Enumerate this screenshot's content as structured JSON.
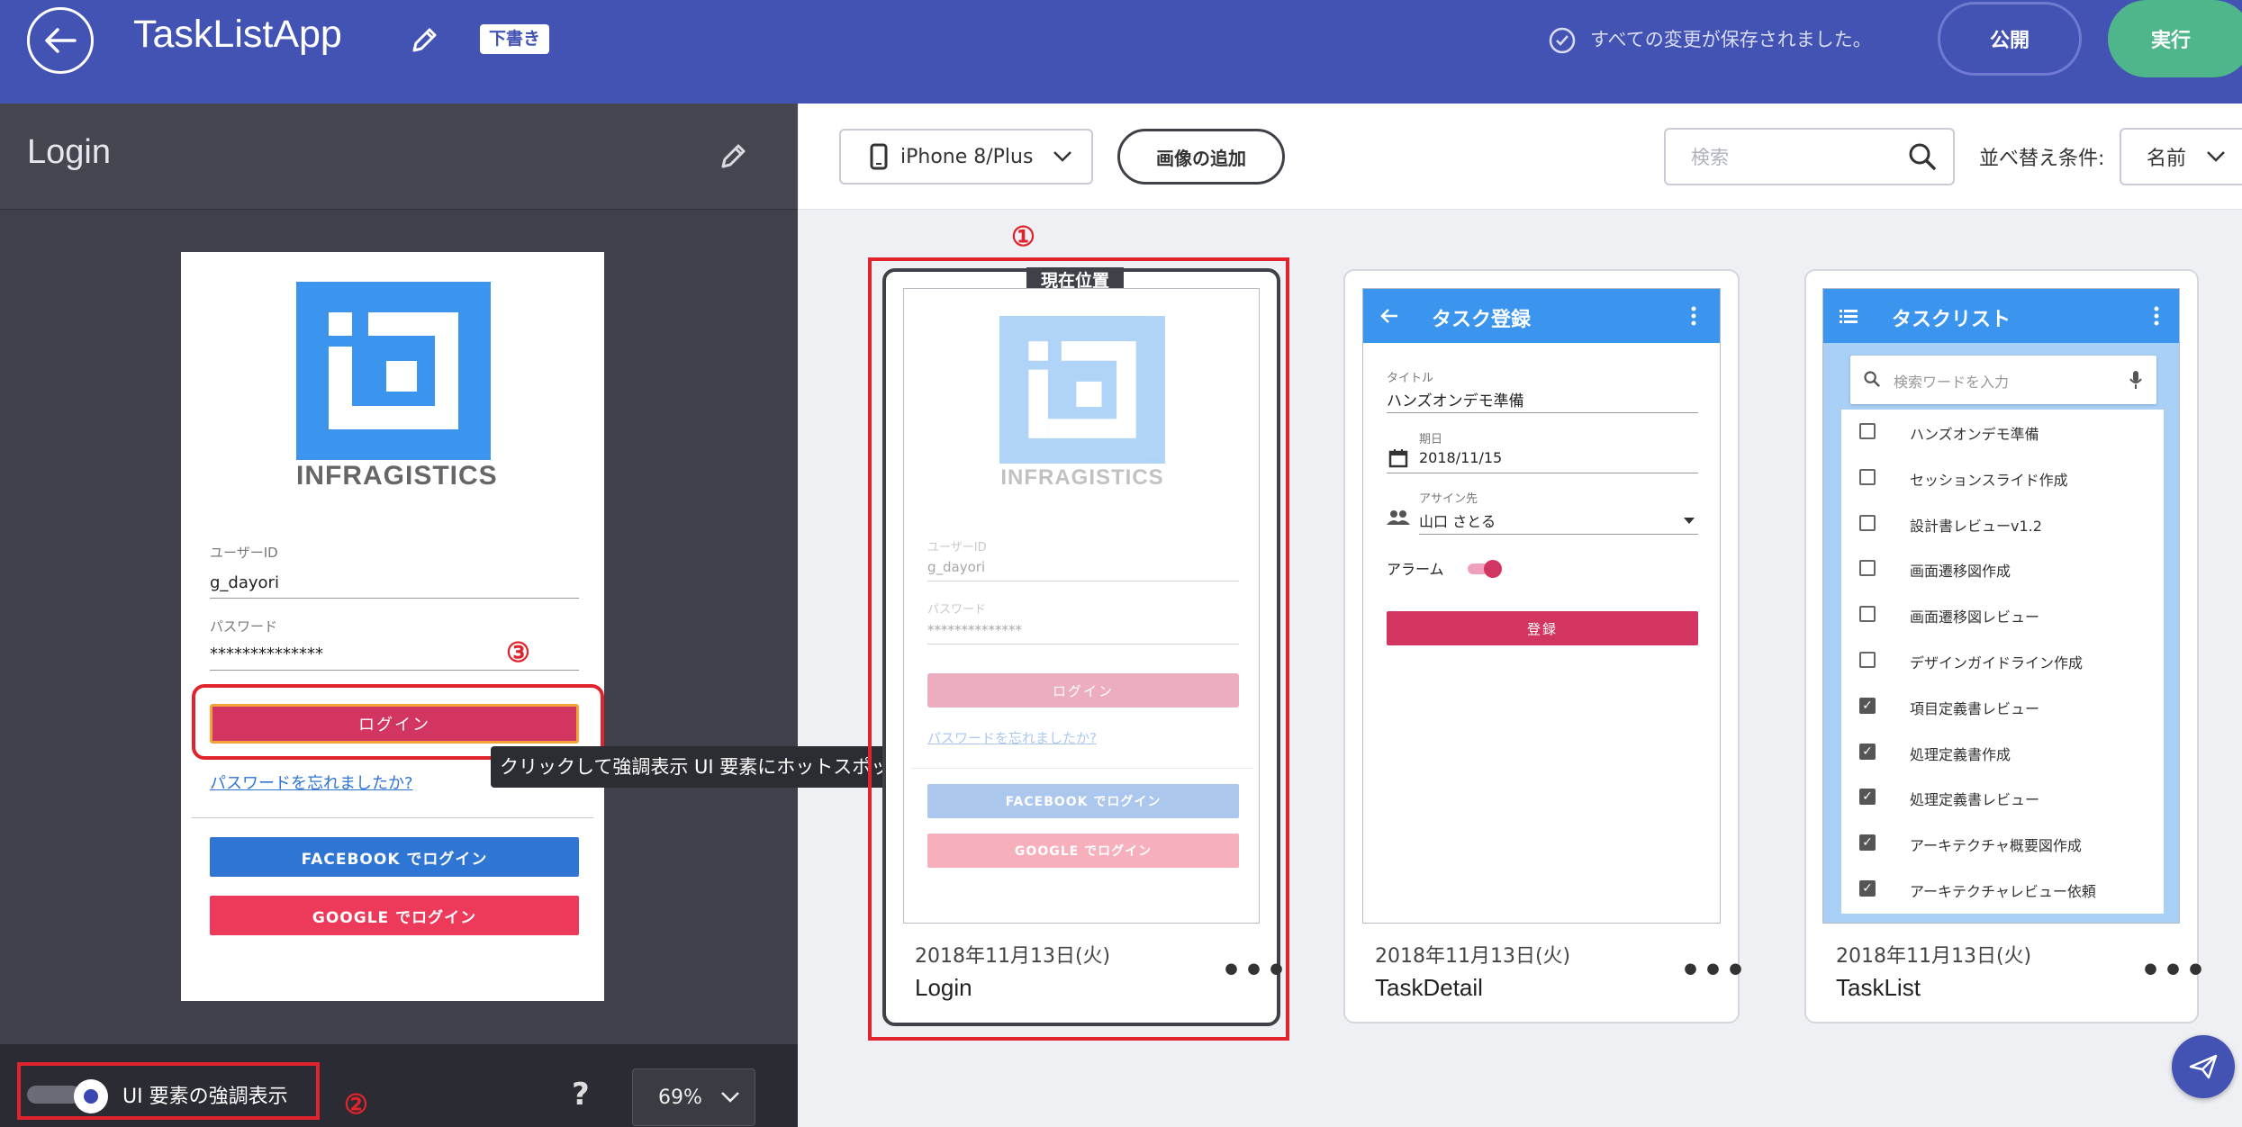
{
  "colors": {
    "topbar": "#4353b3",
    "run": "#4fb58a",
    "highlight_red": "#e0232c",
    "login_pink": "#d2355f",
    "facebook_blue": "#2f75d4",
    "google_red": "#ed3a5a",
    "appbar_blue": "#3b95ef"
  },
  "header": {
    "app_title": "TaskListApp",
    "draft_badge": "下書き",
    "save_status": "すべての変更が保存されました。",
    "publish_label": "公開",
    "run_label": "実行"
  },
  "left": {
    "screen_name": "Login",
    "preview": {
      "logo_text": "INFRAGISTICS",
      "user_id_label": "ユーザーID",
      "user_id_value": "g_dayori",
      "password_label": "パスワード",
      "password_value": "**************",
      "login_button": "ログイン",
      "forgot_link": "パスワードを忘れましたか?",
      "facebook_button": "FACEBOOK でログイン",
      "google_button": "GOOGLE でログイン"
    },
    "tooltip": "クリックして強調表示 UI 要素にホットスポットを作成",
    "highlight_toggle_label": "UI 要素の強調表示",
    "highlight_toggle_on": true,
    "help": "?",
    "zoom": "69%"
  },
  "annotations": {
    "n1": "①",
    "n2": "②",
    "n3": "③"
  },
  "toolbar": {
    "device": "iPhone 8/Plus",
    "add_image": "画像の追加",
    "search_placeholder": "検索",
    "sort_label": "並べ替え条件:",
    "sort_value": "名前"
  },
  "cards": [
    {
      "current_badge": "現在位置",
      "date": "2018年11月13日(火)",
      "name": "Login",
      "more": "•••",
      "thumb": {
        "logo_text": "INFRAGISTICS",
        "user_id_label": "ユーザーID",
        "user_id_value": "g_dayori",
        "password_label": "パスワード",
        "password_value": "**************",
        "login_button": "ログイン",
        "forgot_link": "パスワードを忘れましたか?",
        "facebook_button": "FACEBOOK でログイン",
        "google_button": "GOOGLE でログイン"
      }
    },
    {
      "date": "2018年11月13日(火)",
      "name": "TaskDetail",
      "more": "•••",
      "thumb": {
        "appbar_title": "タスク登録",
        "title_label": "タイトル",
        "title_value": "ハンズオンデモ準備",
        "due_label": "期日",
        "due_value": "2018/11/15",
        "assignee_label": "アサイン先",
        "assignee_value": "山口 さとる",
        "alarm_label": "アラーム",
        "alarm_on": true,
        "submit_button": "登録"
      }
    },
    {
      "date": "2018年11月13日(火)",
      "name": "TaskList",
      "more": "•••",
      "thumb": {
        "appbar_title": "タスクリスト",
        "search_placeholder": "検索ワードを入力",
        "items": [
          {
            "label": "ハンズオンデモ準備",
            "checked": false
          },
          {
            "label": "セッションスライド作成",
            "checked": false
          },
          {
            "label": "設計書レビューv1.2",
            "checked": false
          },
          {
            "label": "画面遷移図作成",
            "checked": false
          },
          {
            "label": "画面遷移図レビュー",
            "checked": false
          },
          {
            "label": "デザインガイドライン作成",
            "checked": false
          },
          {
            "label": "項目定義書レビュー",
            "checked": true
          },
          {
            "label": "処理定義書作成",
            "checked": true
          },
          {
            "label": "処理定義書レビュー",
            "checked": true
          },
          {
            "label": "アーキテクチャ概要図作成",
            "checked": true
          },
          {
            "label": "アーキテクチャレビュー依頼",
            "checked": true
          }
        ]
      }
    }
  ]
}
